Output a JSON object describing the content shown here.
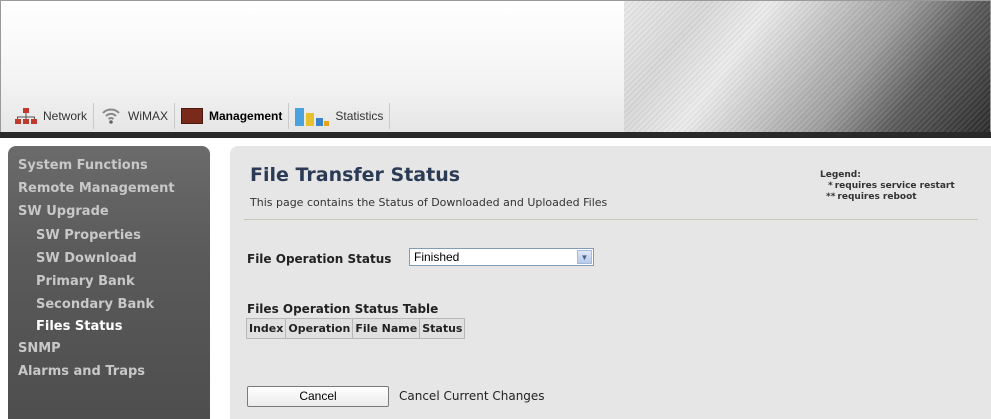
{
  "header": {
    "tabs": [
      {
        "label": "Network",
        "icon": "network-icon"
      },
      {
        "label": "WiMAX",
        "icon": "wimax-signal-icon"
      },
      {
        "label": "Management",
        "icon": "management-monitor-icon",
        "active": true
      },
      {
        "label": "Statistics",
        "icon": "statistics-bar-icon"
      }
    ]
  },
  "sidebar": {
    "items": [
      {
        "label": "System Functions"
      },
      {
        "label": "Remote Management"
      },
      {
        "label": "SW Upgrade"
      },
      {
        "label": "SW Properties"
      },
      {
        "label": "SW Download"
      },
      {
        "label": "Primary Bank"
      },
      {
        "label": "Secondary Bank"
      },
      {
        "label": "Files Status",
        "current": true
      },
      {
        "label": "SNMP"
      },
      {
        "label": "Alarms and Traps"
      }
    ]
  },
  "main": {
    "title": "File Transfer Status",
    "description": "This page contains the Status of Downloaded and Uploaded Files",
    "legend": {
      "title": "Legend:",
      "items": [
        {
          "marker": "*",
          "text": "requires service restart"
        },
        {
          "marker": "**",
          "text": "requires reboot"
        }
      ]
    },
    "file_operation_status": {
      "label": "File Operation Status",
      "value": "Finished"
    },
    "table": {
      "title": "Files Operation Status Table",
      "columns": [
        "Index",
        "Operation",
        "File Name",
        "Status"
      ]
    },
    "cancel": {
      "button_label": "Cancel",
      "description": "Cancel Current Changes"
    }
  },
  "colors": {
    "sidebar_bg": "#5a5a5a",
    "content_bg": "#e6e6e6",
    "title_color": "#2b3a55",
    "header_bar": "#2a2a2a"
  }
}
